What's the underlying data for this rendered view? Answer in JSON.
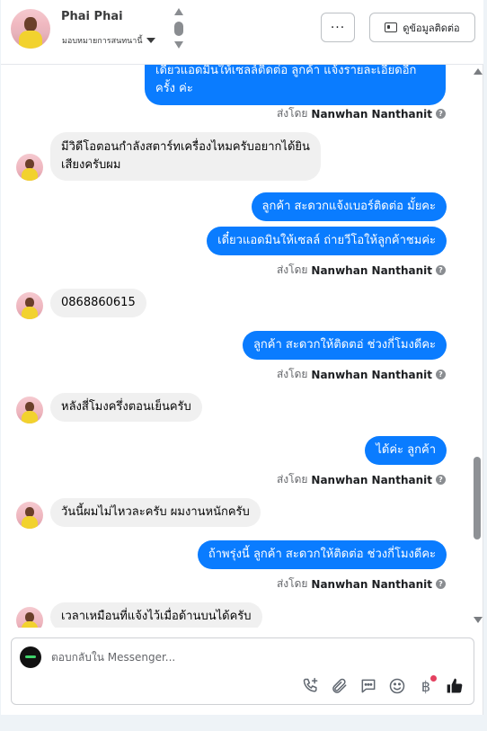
{
  "header": {
    "name": "Phai Phai",
    "assign_label": "มอบหมายการสนทนานี้",
    "more_label": "···",
    "contact_label": "ดูข้อมูลติดต่อ"
  },
  "messages": [
    {
      "dir": "out",
      "lines": [
        "เดี๋ยวแอดมินให้เซลล์ติดต่อ ลูกค้า แจ้งรายละเอียดอีก",
        "ครั้ง ค่ะ"
      ]
    },
    {
      "sent_by_prefix": "ส่งโดย",
      "sent_by_name": "Nanwhan Nanthanit"
    },
    {
      "dir": "in",
      "lines": [
        "มีวิดีโอตอนกำลังสตาร์ทเครื่องไหมครับอยากได้ยิน",
        "เสียงครับผม"
      ]
    },
    {
      "dir": "out",
      "text": "ลูกค้า สะดวกแจ้งเบอร์ติดต่อ มั้ยคะ"
    },
    {
      "dir": "out",
      "text": "เดี๋ยวแอดมินให้เซลล์ ถ่ายวีโอให้ลูกค้าชมค่ะ"
    },
    {
      "dir": "in",
      "text": "0868860615"
    },
    {
      "dir": "out",
      "text": "ลูกค้า สะดวกให้ติดตอ่ ช่วงกี่โมงดีคะ"
    },
    {
      "dir": "in",
      "text": "หลังสี่โมงครึ่งตอนเย็นครับ"
    },
    {
      "dir": "out",
      "text": "ได้ค่ะ  ลูกค้า"
    },
    {
      "dir": "in",
      "text": "วันนี้ผมไม่ไหวละครับ ผมงานหนักครับ"
    },
    {
      "dir": "out",
      "text": "ถ้าพรุ่งนี้ ลูกค้า สะดวกให้ติดต่อ ช่วงกี่โมงดีคะ"
    },
    {
      "dir": "in",
      "text": "เวลาเหมือนที่แจ้งไว้เมื่อด้านบนได้ครับ"
    }
  ],
  "sent_by": {
    "prefix": "ส่งโดย",
    "name": "Nanwhan Nanthanit"
  },
  "composer": {
    "placeholder": "ตอบกลับใน Messenger...",
    "icons": [
      "phone-plus-icon",
      "paperclip-icon",
      "chat-bubble-icon",
      "emoji-icon",
      "baht-icon",
      "thumbs-up-icon"
    ],
    "baht_symbol": "฿"
  },
  "colors": {
    "outgoing": "#0a7cff",
    "incoming": "#f0f0f0",
    "notification": "#e4405f"
  }
}
